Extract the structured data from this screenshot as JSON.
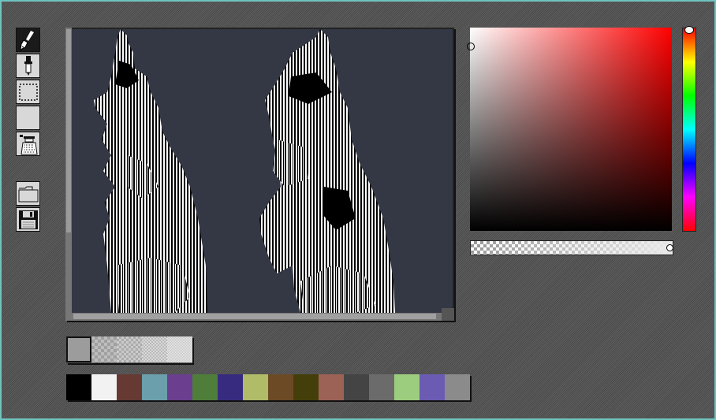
{
  "tools": [
    {
      "name": "paintbrush-icon",
      "selected": true
    },
    {
      "name": "eyedropper-icon",
      "selected": false
    },
    {
      "name": "rect-select-icon",
      "selected": false
    },
    {
      "name": "blank-tool-icon",
      "selected": false
    },
    {
      "name": "spray-can-icon",
      "selected": false
    }
  ],
  "file_tools": [
    {
      "name": "open-folder-icon"
    },
    {
      "name": "save-disk-icon"
    }
  ],
  "colors": {
    "frame": "#6fc2bf",
    "canvas_bg": "#343744",
    "picker_hue": "#ff0000",
    "foreground": "#ffffff"
  },
  "brushes": [
    "#9c9c9c",
    "#b6b6b6",
    "#c4c4c4",
    "#d4d4d4",
    "#e4e4e4"
  ],
  "palette": [
    "#000000",
    "#f2f2f2",
    "#663a32",
    "#6b9fac",
    "#6b3e8f",
    "#4f7e3a",
    "#372b7f",
    "#b0bc68",
    "#6c4a25",
    "#443f0a",
    "#9d6256",
    "#444444",
    "#6b6b6b",
    "#9ccd7e",
    "#6b5bb3",
    "#8b8b8b"
  ]
}
